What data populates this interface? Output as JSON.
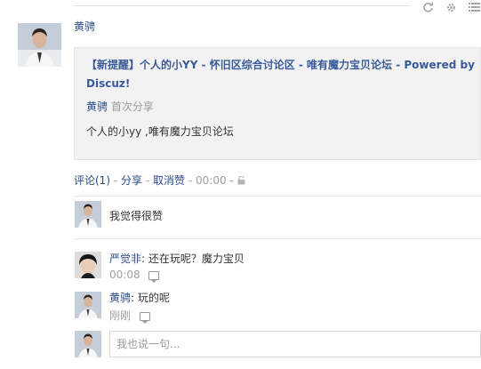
{
  "post": {
    "author": "黄骋",
    "share_title": "【新提醒】个人的小YY - 怀旧区综合讨论区  - 唯有魔力宝贝论坛  - Powered by Discuz!",
    "share_author": "黄骋",
    "share_note": "首次分享",
    "share_desc": "个人的小yy ,唯有魔力宝贝论坛"
  },
  "actions": {
    "comment": "评论(1)",
    "sep1": "-",
    "share": "分享",
    "sep2": "-",
    "unlike": "取消赞",
    "sep3": "-",
    "time": "00:00",
    "sep4": "-"
  },
  "like_row": {
    "text": "我觉得很赞"
  },
  "comments": [
    {
      "author": "严觉非",
      "text": ": 还在玩呢？魔力宝贝",
      "time": "00:08"
    },
    {
      "author": "黄骋",
      "text": ": 玩的呢",
      "time": "刚刚"
    }
  ],
  "input": {
    "placeholder": "我也说一句..."
  },
  "icons": {
    "refresh": "refresh-icon",
    "settings": "gear-icon",
    "list": "list-icon",
    "lock": "lock-icon",
    "comment": "comment-icon"
  },
  "colors": {
    "link": "#3a5b99",
    "name": "#2b4a8a",
    "muted": "#9a9a9a",
    "card_bg": "#f2f2f2"
  }
}
